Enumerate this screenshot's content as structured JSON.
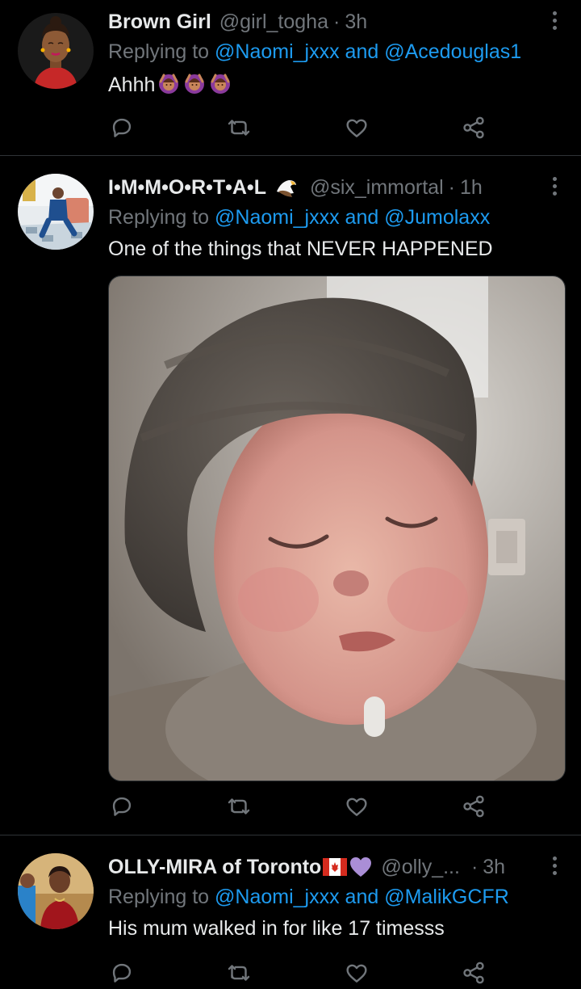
{
  "colors": {
    "background": "#000000",
    "text": "#e7e9ea",
    "secondary": "#71767b",
    "link": "#1d9bf0",
    "divider": "#2f3336"
  },
  "tweets": [
    {
      "name": "Brown Girl",
      "handle": "@girl_togha",
      "dot": "·",
      "time": "3h",
      "reply_prefix": "Replying to ",
      "mention1": "@Naomi_jxxx",
      "and": " and ",
      "mention2": "@Acedouglas1",
      "text": "Ahhh",
      "emojis": [
        "woman-gesturing-ok-icon",
        "woman-gesturing-ok-icon",
        "woman-gesturing-ok-icon"
      ]
    },
    {
      "name": "I•M•M•O•R•T•A•L",
      "handle": "@six_immortal",
      "dot": "·",
      "time": "1h",
      "reply_prefix": "Replying to ",
      "mention1": "@Naomi_jxxx",
      "and": " and ",
      "mention2": "@Jumolaxx",
      "text": "One of the things that NEVER HAPPENED",
      "media": "photo of a sleepy baby wearing a knit beanie"
    },
    {
      "name": "OLLY-MIRA of Toronto",
      "handle": "@olly_...",
      "dot": "·",
      "time": "3h",
      "reply_prefix": "Replying to ",
      "mention1": "@Naomi_jxxx",
      "and": " and ",
      "mention2": "@MalikGCFR",
      "text": "His mum walked in for like 17 timesss"
    }
  ],
  "action_icons": [
    "reply-icon",
    "retweet-icon",
    "like-icon",
    "share-icon"
  ]
}
